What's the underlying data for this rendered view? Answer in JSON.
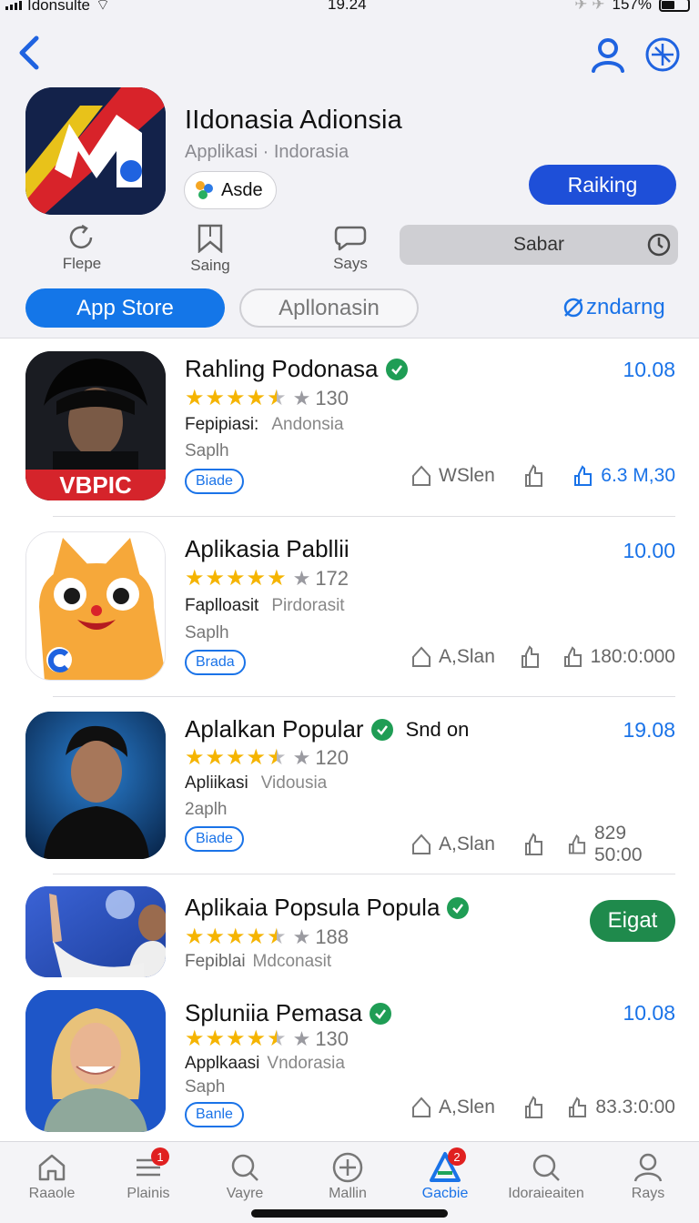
{
  "status": {
    "carrier": "Idonsulte",
    "time": "19.24",
    "battery": "157%"
  },
  "app": {
    "title": "IIdonasia Adionsia",
    "subtitle": "Applikasi · Indorasia",
    "chip": "Asde",
    "primary_button": "Raiking",
    "search_placeholder": "Sabar"
  },
  "mini_actions": [
    {
      "label": "Flepe",
      "icon": "refresh-icon"
    },
    {
      "label": "Saing",
      "icon": "bookmark-icon"
    },
    {
      "label": "Says",
      "icon": "chat-icon"
    }
  ],
  "tabs": {
    "primary": "App Store",
    "secondary": "Apllonasin",
    "link": "zndarng"
  },
  "apps": [
    {
      "name": "Rahling Podonasa",
      "verified": true,
      "extra": "",
      "rating": 4.5,
      "reviews": "130",
      "category": "Fepipiasi:",
      "region": "Andonsia",
      "sub": "Saplh",
      "badge": "Biade",
      "price": "10.08",
      "stat1": "WSlen",
      "stat3": "6.3 M,30",
      "stat3_blue": true,
      "thumb_label": "VBPIC"
    },
    {
      "name": "Aplikasia Pabllii",
      "verified": false,
      "extra": "",
      "rating": 5,
      "reviews": "172",
      "category": "Faplloasit",
      "region": "Pirdorasit",
      "sub": "Saplh",
      "badge": "Brada",
      "price": "10.00",
      "stat1": "A,Slan",
      "stat3": "180:0:000",
      "stat3_blue": false
    },
    {
      "name": "Aplalkan Popular",
      "verified": true,
      "extra": "Snd on",
      "rating": 4.5,
      "reviews": "120",
      "category": "Apliikasi",
      "region": "Vidousia",
      "sub": "2aplh",
      "badge": "Biade",
      "price": "19.08",
      "stat1": "A,Slan",
      "stat3": "829 50:00",
      "stat3_blue": false
    },
    {
      "name": "Aplikaia Popsula Popula",
      "verified": true,
      "extra": "",
      "rating": 4.5,
      "reviews": "188",
      "category": "Fepiblai",
      "region": "Mdconasit",
      "button": "Eigat"
    },
    {
      "name": "Spluniia Pemasa",
      "verified": true,
      "extra": "",
      "rating": 4.5,
      "reviews": "130",
      "category": "Applkaasi",
      "region": "Vndorasia",
      "sub": "Saph",
      "badge": "Banle",
      "price": "10.08",
      "stat1": "A,Slen",
      "stat3": "83.3:0:00",
      "stat3_blue": false
    }
  ],
  "tabbar": [
    {
      "label": "Raaole",
      "icon": "home-icon"
    },
    {
      "label": "Plainis",
      "icon": "menu-icon",
      "badge": "1"
    },
    {
      "label": "Vayre",
      "icon": "search-icon"
    },
    {
      "label": "Mallin",
      "icon": "plus-circle-icon"
    },
    {
      "label": "Gacbie",
      "icon": "store-icon",
      "badge": "2",
      "active": true
    },
    {
      "label": "Idoraieaiten",
      "icon": "search-icon"
    },
    {
      "label": "Rays",
      "icon": "person-icon"
    }
  ],
  "colors": {
    "accent": "#1a73e8",
    "button": "#1e4fd8",
    "verified": "#1f9d55",
    "star": "#f5b400"
  }
}
